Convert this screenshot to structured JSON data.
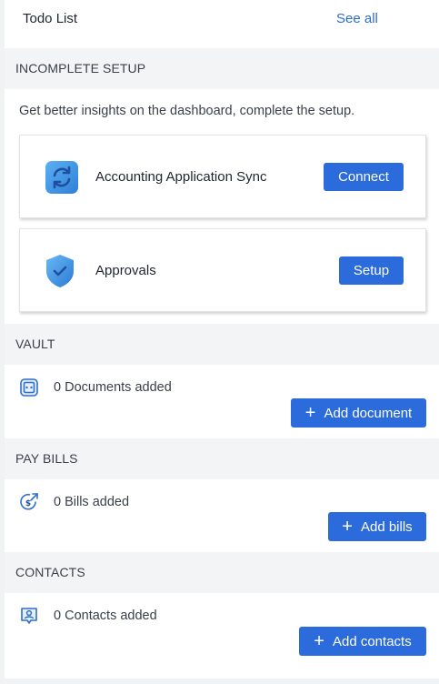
{
  "header": {
    "title": "Todo List",
    "see_all": "See all"
  },
  "incomplete_setup": {
    "heading": "INCOMPLETE SETUP",
    "intro": "Get better insights on the dashboard, complete the setup.",
    "items": [
      {
        "label": "Accounting Application Sync",
        "button": "Connect",
        "icon": "sync-icon"
      },
      {
        "label": "Approvals",
        "button": "Setup",
        "icon": "shield-check-icon"
      }
    ]
  },
  "vault": {
    "heading": "VAULT",
    "status": "0 Documents added",
    "button": "Add document",
    "icon": "document-icon"
  },
  "pay_bills": {
    "heading": "PAY BILLS",
    "status": "0 Bills added",
    "button": "Add bills",
    "icon": "dollar-coin-icon"
  },
  "contacts": {
    "heading": "CONTACTS",
    "status": "0 Contacts added",
    "button": "Add contacts",
    "icon": "contact-card-icon"
  },
  "colors": {
    "accent": "#2b6bdc",
    "link": "#2d6bd6",
    "section_bg": "#f3f4f6"
  }
}
